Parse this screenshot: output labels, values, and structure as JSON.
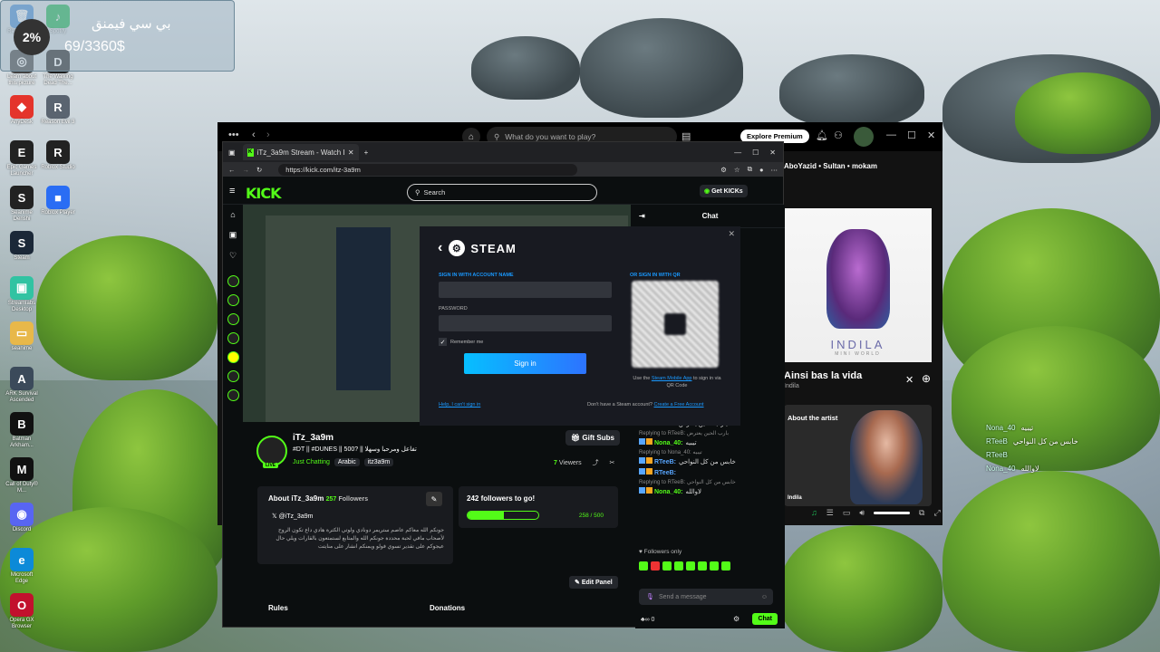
{
  "widget": {
    "percent": "2%",
    "title": "بي سي فيمنق",
    "progress_text": "69/3360$"
  },
  "desktop_icons": [
    {
      "label": "Recycle Bin",
      "color": "#4a90d9",
      "glyph": "🗑"
    },
    {
      "label": "Spotify",
      "color": "#1db954",
      "glyph": "♪"
    },
    {
      "label": "Learn about this picture",
      "color": "#444",
      "glyph": "◎"
    },
    {
      "label": "The Walking Dead The...",
      "color": "#222",
      "glyph": "D"
    },
    {
      "label": "AnyDesk",
      "color": "#e4342b",
      "glyph": "◆"
    },
    {
      "label": "Reason Evil 3",
      "color": "#5a6470",
      "glyph": "R"
    },
    {
      "label": "Epic Games Launcher",
      "color": "#222",
      "glyph": "E"
    },
    {
      "label": "Roblox Studio",
      "color": "#222",
      "glyph": "R"
    },
    {
      "label": "Seanime Denshi",
      "color": "#222",
      "glyph": "S"
    },
    {
      "label": "Roblox Player",
      "color": "#2a6df4",
      "glyph": "■"
    },
    {
      "label": "Steam",
      "color": "#1b2838",
      "glyph": "S"
    },
    {
      "label": "Streamlabs Desktop",
      "color": "#31c3a2",
      "glyph": "▣"
    },
    {
      "label": "seanime",
      "color": "#e8b84a",
      "glyph": "▭"
    },
    {
      "label": "ARK Survival Ascended",
      "color": "#3b4a5a",
      "glyph": "A"
    },
    {
      "label": "Batman Arkham...",
      "color": "#111",
      "glyph": "B"
    },
    {
      "label": "Call of Duty® M...",
      "color": "#111",
      "glyph": "M"
    },
    {
      "label": "Discord",
      "color": "#5865f2",
      "glyph": "◉"
    },
    {
      "label": "Microsoft Edge",
      "color": "#0c8ad8",
      "glyph": "e"
    },
    {
      "label": "Opera GX Browser",
      "color": "#c2112d",
      "glyph": "O"
    }
  ],
  "spotify": {
    "search_placeholder": "What do you want to play?",
    "explore_label": "Explore Premium",
    "now_playing_header": "AboYazid • Sultan • mokam",
    "album_artist": "INDILA",
    "album_sub": "MINI WORLD",
    "track_title": "Ainsi bas la vida",
    "track_artist": "Indila",
    "about_artist_label": "About the artist",
    "artist_caption": "Indila"
  },
  "browser": {
    "tab_title": "iTz_3a9m Stream - Watch Live o...",
    "url": "https://kick.com/itz-3a9m"
  },
  "kick": {
    "logo": "KICK",
    "search_placeholder": "Search",
    "get_kicks": "Get KICKs",
    "streamer_name": "iTz_3a9m",
    "stream_title": "#DT || #DUNES || 500? || تفاعل ومرحبا وسهلا",
    "category": "Just Chatting",
    "tag1": "Arabic",
    "tag2": "itz3a9m",
    "gift_subs": "Gift Subs",
    "viewers_count": "7",
    "viewers_label": "Viewers",
    "live_label": "LIVE",
    "about_title": "About iTz_3a9m",
    "followers_count": "257",
    "followers_label": "Followers",
    "x_handle": "@iTz_3a9m",
    "bio": "جونكم الله معاكم عاصم ستريمر دونادي ولوتي الكترة هادي داع تكون الروح لأصحاب مافي لحبة محددة جونكم الله والمتابع لستمتعون بالقارات ويلي حال عيجوكم على تقدير تسوي فولو ويمنكم انشار على منايتت",
    "goal_title": "242 followers to go!",
    "goal_count": "258 / 500",
    "goal_fraction": 0.516,
    "edit_panel": "Edit Panel",
    "rules": "Rules",
    "donations": "Donations"
  },
  "chat": {
    "title": "Chat",
    "messages": [
      {
        "reply": "Replying to RTeeB: اما ربيت",
        "user": "Nona_40:",
        "text": "اي اي"
      },
      {
        "reply": "",
        "user": "RTeeB:",
        "text": "يارب الحين يعترض"
      },
      {
        "reply": "Replying to RTeeB: بارب الحين يعترض",
        "user": "Nona_40:",
        "text": "تيبيه"
      },
      {
        "reply": "Replying to Nona_40: تيبيه",
        "user": "RTeeB:",
        "text": "خابس من كل النواحي"
      },
      {
        "reply": "",
        "user": "RTeeB:",
        "text": ""
      },
      {
        "reply": "Replying to RTeeB: خابس من كل النواحي",
        "user": "Nona_40:",
        "text": "لاوالله"
      }
    ],
    "followers_only": "Followers only",
    "send_placeholder": "Send a message",
    "kicks_count": "0",
    "chat_button": "Chat"
  },
  "steam": {
    "brand": "STEAM",
    "account_label": "SIGN IN WITH ACCOUNT NAME",
    "password_label": "PASSWORD",
    "remember": "Remember me",
    "sign_in": "Sign in",
    "qr_label": "OR SIGN IN WITH QR",
    "qr_text_pre": "Use the ",
    "qr_link": "Steam Mobile App",
    "qr_text_post": " to sign in via QR Code",
    "help": "Help, I can't sign in",
    "no_account": "Don't have a Steam account?",
    "create": "Create a Free Account"
  },
  "overlay_chat": [
    {
      "user": "Nona_40",
      "text": "تيبيه"
    },
    {
      "user": "RTeeB",
      "text": "خابس من كل النواحي"
    },
    {
      "user": "RTeeB",
      "text": ""
    },
    {
      "user": "Nona_40",
      "text": "لاوالله"
    }
  ],
  "colors": {
    "kick_green": "#53fc18",
    "steam_blue": "#1999ff",
    "spotify_green": "#1db954"
  }
}
